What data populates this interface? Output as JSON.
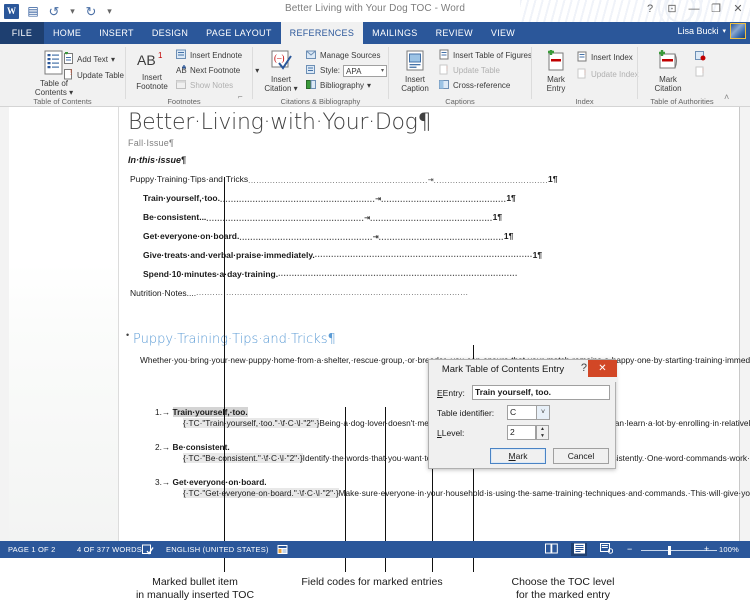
{
  "window": {
    "title": "Better Living with Your Dog TOC - Word",
    "quick_access": [
      "word-icon",
      "save-icon",
      "undo-icon",
      "redo-icon",
      "customize-qat-icon"
    ],
    "help_label": "?",
    "ribbon_display_label": "ribbon-display-options",
    "minimize_label": "minimize",
    "restore_label": "restore",
    "close_label": "close"
  },
  "tabs": {
    "file": "FILE",
    "items": [
      {
        "label": "HOME",
        "active": false
      },
      {
        "label": "INSERT",
        "active": false
      },
      {
        "label": "DESIGN",
        "active": false
      },
      {
        "label": "PAGE LAYOUT",
        "active": false
      },
      {
        "label": "REFERENCES",
        "active": true
      },
      {
        "label": "MAILINGS",
        "active": false
      },
      {
        "label": "REVIEW",
        "active": false
      },
      {
        "label": "VIEW",
        "active": false
      }
    ],
    "account_name": "Lisa Bucki"
  },
  "ribbon": {
    "groups": [
      {
        "name": "Table of Contents",
        "label": "Table of Contents",
        "big_button": "Table of\nContents",
        "big_button_line1": "Table of",
        "big_button_line2": "Contents",
        "small_buttons": [
          {
            "label": "Add Text",
            "dropdown": true,
            "disabled": false
          },
          {
            "label": "Update Table",
            "dropdown": false,
            "disabled": false
          }
        ]
      },
      {
        "name": "Footnotes",
        "label": "Footnotes",
        "big_button_line1": "Insert",
        "big_button_line2": "Footnote",
        "big_glyph": "AB1",
        "small_buttons": [
          {
            "label": "Insert Endnote",
            "dropdown": false,
            "disabled": false
          },
          {
            "label": "Next Footnote",
            "dropdown": true,
            "disabled": false
          },
          {
            "label": "Show Notes",
            "dropdown": false,
            "disabled": true
          }
        ],
        "has_dialog_launcher": true
      },
      {
        "name": "Citations & Bibliography",
        "label": "Citations & Bibliography",
        "big_button_line1": "Insert",
        "big_button_line2": "Citation",
        "small_buttons": [
          {
            "label": "Manage Sources",
            "dropdown": false,
            "disabled": false
          },
          {
            "label": "Style:",
            "dropdown": false,
            "disabled": false
          },
          {
            "label": "Bibliography",
            "dropdown": true,
            "disabled": false
          }
        ],
        "style_value": "APA"
      },
      {
        "name": "Captions",
        "label": "Captions",
        "big_button_line1": "Insert",
        "big_button_line2": "Caption",
        "small_buttons": [
          {
            "label": "Insert Table of Figures",
            "dropdown": false,
            "disabled": false
          },
          {
            "label": "Update Table",
            "dropdown": false,
            "disabled": true
          },
          {
            "label": "Cross-reference",
            "dropdown": false,
            "disabled": false
          }
        ]
      },
      {
        "name": "Index",
        "label": "Index",
        "big_button_line1": "Mark",
        "big_button_line2": "Entry",
        "small_buttons": [
          {
            "label": "Insert Index",
            "dropdown": false,
            "disabled": false
          },
          {
            "label": "Update Index",
            "dropdown": false,
            "disabled": true
          }
        ]
      },
      {
        "name": "Table of Authorities",
        "label": "Table of Authorities",
        "big_button_line1": "Mark",
        "big_button_line2": "Citation",
        "small_buttons": []
      }
    ],
    "collapse_label": "collapse-ribbon"
  },
  "document": {
    "heading": "Better·Living·with·Your·Dog¶",
    "subtitle": "Fall·Issue¶",
    "in_this_issue": "In·this·issue¶",
    "toc_entries": [
      {
        "text": "Puppy·Training·Tips·and·Tricks",
        "page": "1¶",
        "level": 1,
        "dots_before": 58,
        "dots_after": 40
      },
      {
        "text": "Train·yourself,·too.",
        "page": "1¶",
        "level": 2,
        "dots_before": 47,
        "dots_after": 44
      },
      {
        "text": "Be·consistent...",
        "page": "1¶",
        "level": 2,
        "dots_before": 45,
        "dots_after": 43
      },
      {
        "text": "Get·everyone·on·board.",
        "page": "1¶",
        "level": 2,
        "dots_before": 42,
        "dots_after": 43
      },
      {
        "text": "Give·treats·and·verbal·praise·immediately.",
        "page": "1¶",
        "level": 2,
        "dots_before": 28,
        "dots_after": 0
      },
      {
        "text": "Spend·10·minutes·a·day·training.",
        "page": "",
        "level": 2,
        "dots_before": 38,
        "dots_after": 0
      },
      {
        "text": "Nutrition·Notes....",
        "page": "",
        "level": 1,
        "dots_before": 52,
        "dots_after": 0
      }
    ],
    "section_heading": "Puppy·Training·Tips·and·Tricks¶",
    "body_paragraph": "Whether·you·bring·your·new·puppy·home·from·a·shelter,·rescue·group,·or·breeder,·you·can·ensure·that·your·match·remains·a·happy·one·by·starting·training·immediately.·Any·dog·can·learn·the·rules·and·expectations·that·make·for·good·behavior.·Here·are·five·tips·and·tricks·to·help·you·train·your·puppy·right:¶",
    "list_items": [
      {
        "number": "1.",
        "marked_text": "Train·yourself,·too.",
        "field_code": "{·TC·\"Train·yourself,·too.\"·\\f·C·\\l·\"2\"·}",
        "rest": "Being·a·dog·lover·doesn't·mean·you·understand·how·to·train·your·puppy.·You·can·learn·a·lot·by·enrolling·in·relatively·inexpensive·basic·dog·training·courses·from·your·local·pet·retailer·or·obedience·club.¶"
      },
      {
        "number": "2.",
        "marked_text": "Be·consistent.",
        "field_code": "{·TC·\"Be·consistent.\"·\\f·C·\\l·\"2\"·}",
        "rest": "Identify·the·words·that·you·want·to·use·for·particular·commands,·and·use·them·consistently.·One·word·commands·work·best.·For·example,·use·\"Down!\"·instead·of·\"Lay·Down!\"¶"
      },
      {
        "number": "3.",
        "marked_text": "Get·everyone·on·board.",
        "field_code": "{·TC·\"Get·everyone·on·board.\"·\\f·C·\\l·\"2\"·}",
        "rest": "Make·sure·everyone·in·your·household·is·using·the·same·training·techniques·and·commands.·This·will·give·your·pup·lots·of·practice·and·ensure·he·or·she·listens·to·everyone.¶"
      }
    ]
  },
  "dialog": {
    "title": "Mark Table of Contents Entry",
    "help_label": "?",
    "close_label": "✕",
    "entry_label": "Entry:",
    "entry_value": "Train yourself, too.",
    "table_identifier_label": "Table identifier:",
    "table_identifier_value": "C",
    "level_label": "Level:",
    "level_value": "2",
    "mark_button": "Mark",
    "cancel_button": "Cancel"
  },
  "statusbar": {
    "page": "PAGE 1 OF 2",
    "words": "4 OF 377 WORDS",
    "proofing_icon": "proofing-errors-icon",
    "language": "ENGLISH (UNITED STATES)",
    "macro_icon": "macro-recording-icon",
    "views": [
      {
        "name": "read-mode",
        "glyph": "▥",
        "active": false
      },
      {
        "name": "print-layout",
        "glyph": "▤",
        "active": true
      },
      {
        "name": "web-layout",
        "glyph": "▦",
        "active": false
      }
    ],
    "zoom_out": "−",
    "zoom_in": "+",
    "zoom_level": "100%"
  },
  "captions": [
    {
      "line1": "Marked bullet item",
      "line2": "in manually inserted TOC"
    },
    {
      "line1": "Field codes for marked entries",
      "line2": ""
    },
    {
      "line1": "Choose the TOC level",
      "line2": "for the marked entry"
    }
  ]
}
